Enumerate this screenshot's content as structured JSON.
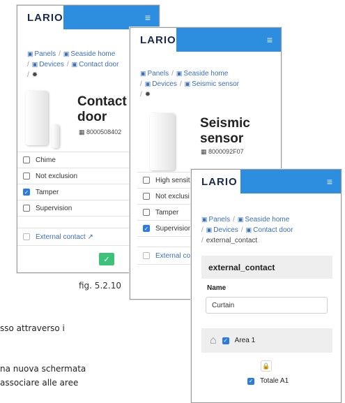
{
  "background_text": {
    "line1": "sso attraverso i",
    "line2": "na nuova schermata",
    "line3": "associare alle aree"
  },
  "caption": "fig. 5.2.10",
  "brand": "LARIO",
  "menu_icon": "hamburger-menu-icon",
  "colors": {
    "topbar": "#2d8ee0",
    "link": "#3b6fb6",
    "checked": "#2d7be0",
    "confirm": "#3ec27a"
  },
  "screen1": {
    "breadcrumb": {
      "panels": "Panels",
      "home": "Seaside home",
      "devices": "Devices",
      "device": "Contact door"
    },
    "title_line1": "Contact",
    "title_line2": "door",
    "serial": "8000508402",
    "options": [
      {
        "label": "Chime",
        "checked": false
      },
      {
        "label": "Not exclusion",
        "checked": false
      },
      {
        "label": "Tamper",
        "checked": true
      },
      {
        "label": "Supervision",
        "checked": false
      }
    ],
    "external_contact": "External contact",
    "confirm_icon": "checkmark-icon"
  },
  "screen2": {
    "breadcrumb": {
      "panels": "Panels",
      "home": "Seaside home",
      "devices": "Devices",
      "device": "Seismic sensor"
    },
    "title_line1": "Seismic",
    "title_line2": "sensor",
    "serial": "8000092F07",
    "options": [
      {
        "label": "High sensiti",
        "checked": false
      },
      {
        "label": "Not exclusi",
        "checked": false
      },
      {
        "label": "Tamper",
        "checked": false
      },
      {
        "label": "Supervision",
        "checked": true
      }
    ],
    "external_contact": "External co"
  },
  "screen3": {
    "breadcrumb": {
      "panels": "Panels",
      "home": "Seaside home",
      "devices": "Devices",
      "device": "Contact door",
      "current": "external_contact"
    },
    "card_title": "external_contact",
    "name_label": "Name",
    "name_value": "Curtain",
    "area_label": "Area 1",
    "area_checked": true,
    "sub_label": "Totale A1",
    "sub_checked": true
  }
}
